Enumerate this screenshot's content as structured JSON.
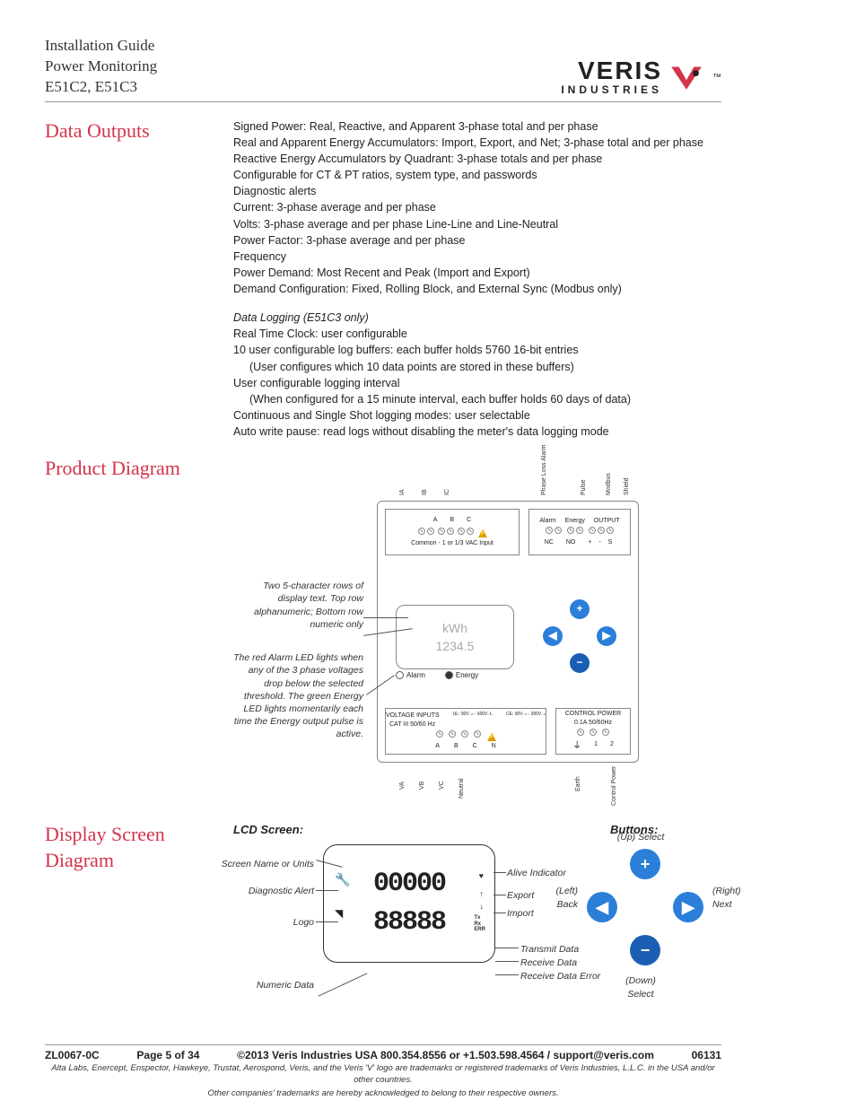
{
  "header": {
    "line1": "Installation Guide",
    "line2": "Power Monitoring",
    "line3": "E51C2, E51C3",
    "logo_top": "VERIS",
    "logo_bottom": "INDUSTRIES",
    "tm": "™"
  },
  "sections": {
    "data_outputs": {
      "title": "Data Outputs",
      "lines": [
        "Signed Power: Real, Reactive, and Apparent 3-phase total and per phase",
        "Real and Apparent Energy Accumulators:  Import, Export, and Net; 3-phase total and per phase",
        "Reactive Energy Accumulators by Quadrant:  3-phase totals and per phase",
        "Configurable for CT & PT ratios, system type, and passwords",
        "Diagnostic alerts",
        "Current: 3-phase average and per phase",
        "Volts: 3-phase average and per phase Line-Line and Line-Neutral",
        "Power Factor: 3-phase average and per phase",
        "Frequency",
        "Power Demand: Most Recent and Peak (Import and Export)",
        "Demand Configuration: Fixed, Rolling Block, and External Sync (Modbus only)"
      ],
      "sub_heading": "Data Logging (E51C3 only)",
      "sub_lines": [
        "Real Time Clock:  user configurable",
        "10 user configurable log buffers:  each buffer holds 5760 16-bit entries",
        "(User configures which 10 data points are stored in these buffers)",
        "User configurable logging interval",
        "(When configured for a 15 minute interval, each buffer holds 60 days of data)",
        "Continuous and Single Shot logging modes:  user selectable",
        "Auto write pause:  read logs without disabling the meter's data logging mode"
      ],
      "sub_indent": [
        false,
        false,
        true,
        false,
        true,
        false,
        false
      ]
    },
    "product_diagram": {
      "title": "Product Diagram",
      "top_terminals": {
        "group_labels": [
          "A",
          "B",
          "C"
        ],
        "sub": "Common - 1 or 1/3 VAC Input",
        "vlabels_left": [
          "IA",
          "IB",
          "IC"
        ],
        "alarm": "Alarm",
        "nc": "NC",
        "energy": "Energy",
        "no": "NO",
        "output": "OUTPUT",
        "out_sub": [
          "+",
          "-",
          "S"
        ],
        "vlabels_right": [
          "Phase Loss Alarm",
          "Pulse",
          "Modbus",
          "Shield"
        ]
      },
      "lcd": {
        "top": "kWh",
        "bottom": "1234.5"
      },
      "leds": {
        "alarm": "Alarm",
        "energy": "Energy"
      },
      "bottom_left": {
        "heading": "VOLTAGE INPUTS",
        "cat": "CAT III  50/60 Hz",
        "ul": "UL: 90V₋ₙ - 600V₋L",
        "ce": "CE: 90V₋ₙ - 300V₋ₙ",
        "labels": [
          "A",
          "B",
          "C",
          "N"
        ],
        "vlabels": [
          "VA",
          "VB",
          "VC",
          "Neutral"
        ]
      },
      "bottom_right": {
        "heading": "CONTROL POWER",
        "sub": "0.1A  50/60Hz",
        "labels": [
          "⏚",
          "1",
          "2"
        ],
        "vlabels": [
          "Earth",
          "Control Power"
        ]
      },
      "callout1": "Two 5-character rows of display text. Top row alphanumeric; Bottom row numeric only",
      "callout2": "The red Alarm LED lights when any of the 3 phase voltages drop below the selected threshold.  The green Energy LED lights momentarily each time the Energy output pulse is active."
    },
    "display_diagram": {
      "title": "Display Screen Diagram",
      "lcd_heading": "LCD Screen:",
      "buttons_heading": "Buttons:",
      "lcd_labels": {
        "screen_name": "Screen Name or Units",
        "diag": "Diagnostic Alert",
        "logo": "Logo",
        "numeric": "Numeric Data",
        "alive": "Alive Indicator",
        "export": "Export",
        "import": "Import",
        "tx": "Transmit Data",
        "rx": "Receive Data",
        "err": "Receive Data Error",
        "tx_s": "Tx",
        "rx_s": "Rx",
        "err_s": "ERR"
      },
      "button_labels": {
        "up": "(Up) Select",
        "down": "(Down) Select",
        "left": "(Left) Back",
        "right": "(Right) Next"
      }
    }
  },
  "footer": {
    "left": "ZL0067-0C",
    "page": "Page 5 of 34",
    "center": "©2013 Veris Industries   USA 800.354.8556 or +1.503.598.4564  / support@veris.com",
    "right": "06131",
    "fine1": "Alta Labs, Enercept, Enspector, Hawkeye, Trustat, Aerospond, Veris, and the Veris 'V' logo are trademarks or registered trademarks of  Veris Industries, L.L.C. in the USA and/or other countries.",
    "fine2": "Other companies' trademarks are hereby acknowledged to belong to their respective owners."
  }
}
